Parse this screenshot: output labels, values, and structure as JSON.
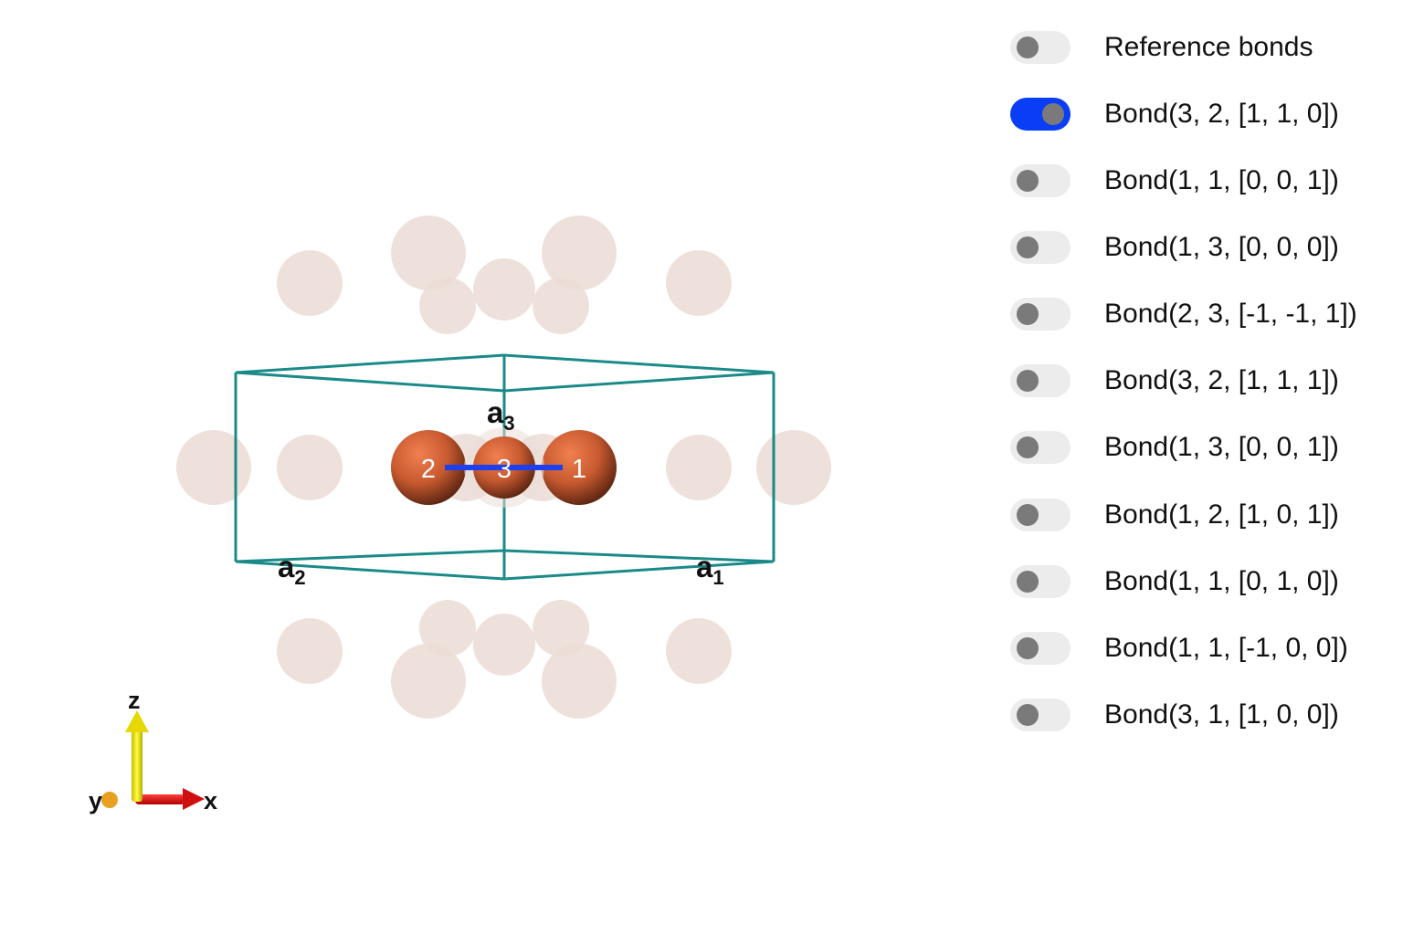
{
  "colors": {
    "accent_on": "#0a3ef6",
    "toggle_off": "#ececec",
    "knob": "#7a7a7a",
    "cell_edges": "#1a8a88",
    "atom": "#c85a30",
    "ghost_atom": "#ebdcd6",
    "bond": "#1c3ff0"
  },
  "legend": {
    "items": [
      {
        "label": "Reference bonds",
        "on": false
      },
      {
        "label": "Bond(3, 2, [1, 1, 0])",
        "on": true
      },
      {
        "label": "Bond(1, 1, [0, 0, 1])",
        "on": false
      },
      {
        "label": "Bond(1, 3, [0, 0, 0])",
        "on": false
      },
      {
        "label": "Bond(2, 3, [-1, -1, 1])",
        "on": false
      },
      {
        "label": "Bond(3, 2, [1, 1, 1])",
        "on": false
      },
      {
        "label": "Bond(1, 3, [0, 0, 1])",
        "on": false
      },
      {
        "label": "Bond(1, 2, [1, 0, 1])",
        "on": false
      },
      {
        "label": "Bond(1, 1, [0, 1, 0])",
        "on": false
      },
      {
        "label": "Bond(1, 1, [-1, 0, 0])",
        "on": false
      },
      {
        "label": "Bond(3, 1, [1, 0, 0])",
        "on": false
      }
    ]
  },
  "scene": {
    "lattice": {
      "a1": "a",
      "a2": "a",
      "a3": "a",
      "sub1": "1",
      "sub2": "2",
      "sub3": "3"
    },
    "atoms": {
      "label1": "1",
      "label2": "2",
      "label3": "3"
    },
    "axes": {
      "x": "x",
      "y": "y",
      "z": "z"
    }
  }
}
